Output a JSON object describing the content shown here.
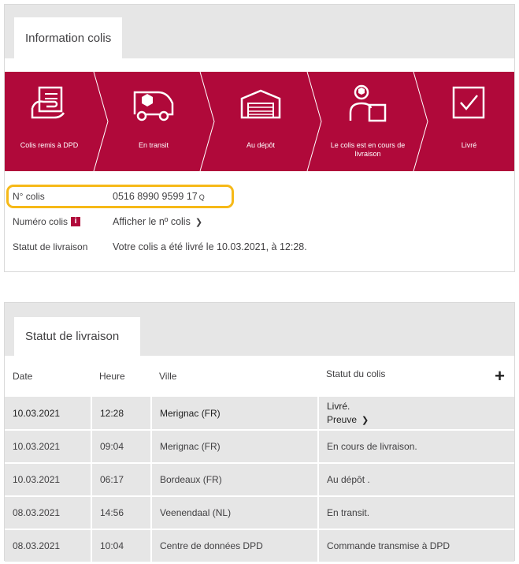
{
  "info_card": {
    "tab_label": "Information colis",
    "steps": [
      {
        "label": "Colis remis à DPD",
        "icon": "handover-icon"
      },
      {
        "label": "En transit",
        "icon": "van-icon"
      },
      {
        "label": "Au dépôt",
        "icon": "depot-icon"
      },
      {
        "label": "Le colis est en cours de livraison",
        "icon": "courier-icon"
      },
      {
        "label": "Livré",
        "icon": "checkbox-icon"
      }
    ],
    "rows": {
      "parcel_no_label": "N° colis",
      "parcel_no_value": "0516 8990 9599 17",
      "parcel_no_suffix": "Q",
      "numero_label": "Numéro colis",
      "numero_badge": "i",
      "numero_link": "Afficher le nº colis",
      "status_label": "Statut de livraison",
      "status_value": "Votre colis a été livré le 10.03.2021, à 12:28."
    }
  },
  "status_card": {
    "tab_label": "Statut de livraison",
    "headers": [
      "Date",
      "Heure",
      "Ville",
      "Statut du colis"
    ],
    "expand_symbol": "+",
    "rows": [
      {
        "date": "10.03.2021",
        "time": "12:28",
        "city": "Merignac (FR)",
        "status": "Livré.",
        "link": "Preuve"
      },
      {
        "date": "10.03.2021",
        "time": "09:04",
        "city": "Merignac (FR)",
        "status": "En cours de livraison."
      },
      {
        "date": "10.03.2021",
        "time": "06:17",
        "city": "Bordeaux (FR)",
        "status": "Au dépôt ."
      },
      {
        "date": "08.03.2021",
        "time": "14:56",
        "city": "Veenendaal (NL)",
        "status": "En transit."
      },
      {
        "date": "08.03.2021",
        "time": "10:04",
        "city": "Centre de données DPD",
        "status": "Commande transmise à DPD"
      }
    ]
  },
  "colors": {
    "brand": "#b0093a",
    "highlight": "#f6b918",
    "row_bg": "#e6e6e6"
  }
}
